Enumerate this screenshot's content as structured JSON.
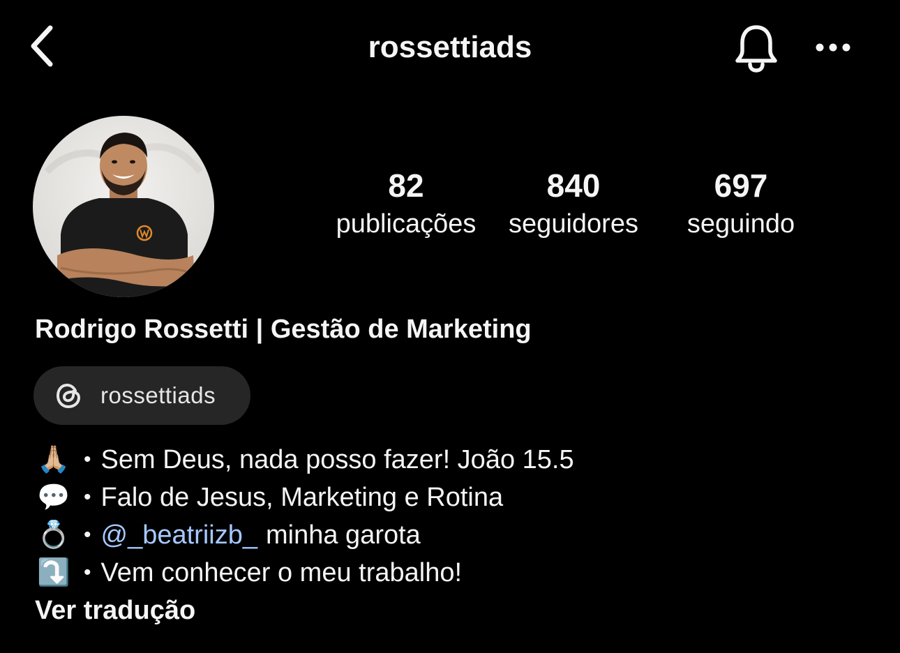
{
  "header": {
    "username": "rossettiads",
    "back_icon": "chevron-left-icon",
    "bell_icon": "bell-icon",
    "more_icon": "more-horizontal-icon"
  },
  "profile": {
    "avatar_icon": "avatar",
    "display_name": "Rodrigo Rossetti | Gestão de Marketing",
    "stats": [
      {
        "count": "82",
        "label": "publicações"
      },
      {
        "count": "840",
        "label": "seguidores"
      },
      {
        "count": "697",
        "label": "seguindo"
      }
    ],
    "threads": {
      "icon": "threads-icon",
      "label": "rossettiads"
    },
    "bio": {
      "bullet": "•",
      "lines": [
        {
          "emoji": "🙏🏼",
          "text": "Sem Deus, nada posso fazer! João 15.5"
        },
        {
          "emoji": "💬",
          "text": "Falo de Jesus, Marketing e Rotina"
        },
        {
          "emoji": "💍",
          "mention": "@_beatriizb_",
          "text": "minha garota"
        },
        {
          "emoji": "⤵️",
          "text": "Vem conhecer o meu trabalho!"
        }
      ]
    },
    "translate_label": "Ver tradução"
  },
  "colors": {
    "background": "#000000",
    "text": "#f5f5f5",
    "chip_background": "#262626",
    "mention": "#a6c8ff",
    "avatar_accent": "#e08a2c"
  }
}
